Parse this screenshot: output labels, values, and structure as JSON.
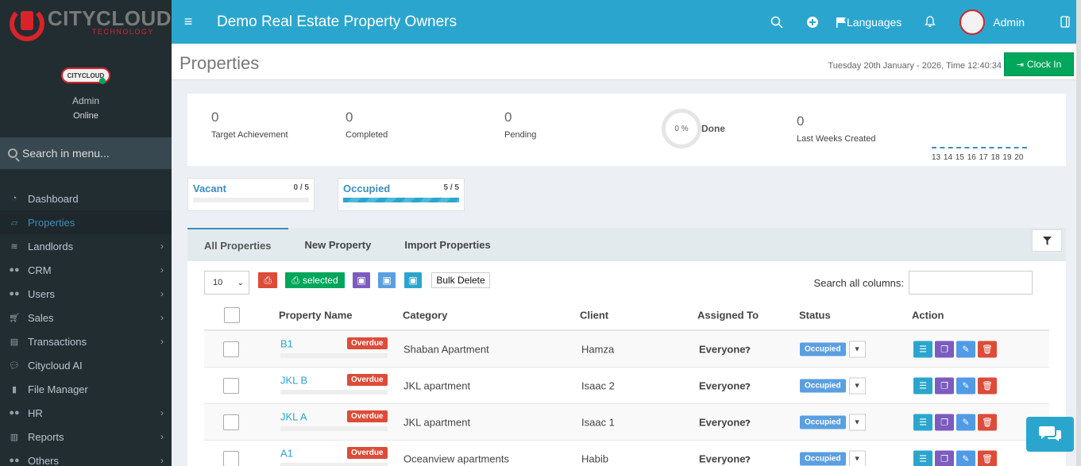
{
  "brand": {
    "name": "CITYCLOUD",
    "tagline": "TECHNOLOGY"
  },
  "user": {
    "badge": "CITYCLOUD",
    "name": "Admin",
    "status": "Online"
  },
  "sidebar": {
    "search_placeholder": "Search in menu...",
    "items": [
      {
        "label": "Dashboard",
        "icon": "dashboard-icon",
        "has_children": false
      },
      {
        "label": "Properties",
        "icon": "folder-open-icon",
        "has_children": false,
        "active": true
      },
      {
        "label": "Landlords",
        "icon": "layers-icon",
        "has_children": true
      },
      {
        "label": "CRM",
        "icon": "users-icon",
        "has_children": true
      },
      {
        "label": "Users",
        "icon": "users-icon",
        "has_children": true
      },
      {
        "label": "Sales",
        "icon": "cart-icon",
        "has_children": true
      },
      {
        "label": "Transactions",
        "icon": "document-icon",
        "has_children": true
      },
      {
        "label": "Citycloud AI",
        "icon": "chat-icon",
        "has_children": false
      },
      {
        "label": "File Manager",
        "icon": "file-icon",
        "has_children": false
      },
      {
        "label": "HR",
        "icon": "users-icon",
        "has_children": true
      },
      {
        "label": "Reports",
        "icon": "bar-chart-icon",
        "has_children": true
      },
      {
        "label": "Others",
        "icon": "users-icon",
        "has_children": true
      }
    ]
  },
  "header": {
    "title": "Demo Real Estate Property Owners",
    "languages_label": "Languages",
    "user_label": "Admin"
  },
  "page": {
    "title": "Properties",
    "datetime": "Tuesday 20th January - 2026,  Time  12:40:34",
    "clock_in_label": "Clock In"
  },
  "stats": {
    "target_value": "0",
    "target_label": "Target Achievement",
    "completed_value": "0",
    "completed_label": "Completed",
    "pending_value": "0",
    "pending_label": "Pending",
    "done_percent": "0 %",
    "done_label": "Done",
    "last_weeks_value": "0",
    "last_weeks_label": "Last Weeks Created",
    "spark_labels": "13 14 15 16 17 18 19 20"
  },
  "occupancy": {
    "vacant": {
      "label": "Vacant",
      "count": "0 / 5",
      "fill": 0
    },
    "occupied": {
      "label": "Occupied",
      "count": "5 / 5",
      "fill": 1
    }
  },
  "tabs": [
    {
      "label": "All Properties",
      "active": true
    },
    {
      "label": "New Property"
    },
    {
      "label": "Import Properties"
    }
  ],
  "toolbar": {
    "page_length": "10",
    "selected_label": "selected",
    "bulk_delete_label": "Bulk Delete",
    "search_label": "Search all columns:"
  },
  "table": {
    "columns": [
      "Property Name",
      "Category",
      "Client",
      "Assigned To",
      "Status",
      "Action"
    ],
    "rows": [
      {
        "name": "B1",
        "badge": "Overdue",
        "category": "Shaban Apartment",
        "client": "Hamza",
        "assigned": "Everyone",
        "status": "Occupied"
      },
      {
        "name": "JKL B",
        "badge": "Overdue",
        "category": "JKL apartment",
        "client": "Isaac 2",
        "assigned": "Everyone",
        "status": "Occupied"
      },
      {
        "name": "JKL A",
        "badge": "Overdue",
        "category": "JKL apartment",
        "client": "Isaac 1",
        "assigned": "Everyone",
        "status": "Occupied"
      },
      {
        "name": "A1",
        "badge": "Overdue",
        "category": "Oceanview apartments",
        "client": "Habib",
        "assigned": "Everyone",
        "status": "Occupied"
      }
    ]
  },
  "colors": {
    "topbar": "#2aa6ce",
    "sidebar": "#222d32",
    "accent": "#3c8dbc",
    "success": "#00a65a",
    "danger": "#dd4b39"
  }
}
